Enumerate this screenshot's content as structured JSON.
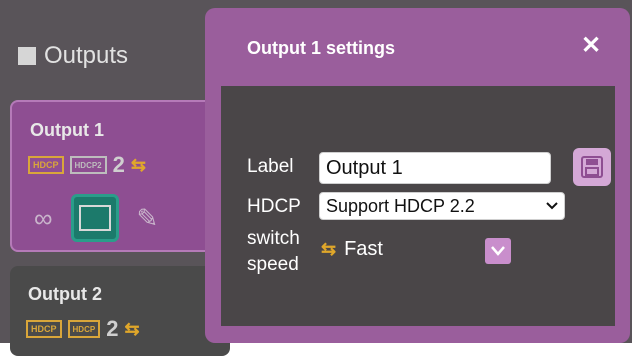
{
  "outputs": {
    "header": "Outputs",
    "cards": [
      {
        "title": "Output 1",
        "hdcp": "HDCP",
        "hdcp2": "HDCP2",
        "count": "2"
      },
      {
        "title": "Output 2",
        "hdcp": "HDCP",
        "hdcp2": "HDCP",
        "count": "2"
      }
    ]
  },
  "dialog": {
    "title": "Output 1 settings",
    "close": "✕",
    "label_label": "Label",
    "label_value": "Output 1",
    "hdcp_label": "HDCP",
    "hdcp_value": "Support HDCP 2.2",
    "switch_label_1": "switch",
    "switch_label_2": "speed",
    "switch_value": "Fast"
  },
  "colors": {
    "accent": "#9a5e9c",
    "gold": "#d9a63a",
    "teal": "#1c7a6b"
  }
}
